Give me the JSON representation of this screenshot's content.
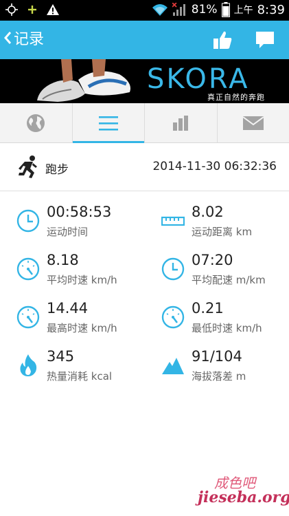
{
  "status_bar": {
    "battery": "81%",
    "ampm": "上午",
    "time": "8:39",
    "icons": [
      "gps-icon",
      "plus-icon",
      "warning-icon",
      "wifi-icon",
      "signal-icon",
      "battery-icon"
    ]
  },
  "header": {
    "back_label": "记录",
    "actions": [
      "thumbs-up-icon",
      "message-icon"
    ],
    "accent_color": "#33b5e5"
  },
  "banner": {
    "brand": "SKORA",
    "slogan": "真正自然的奔跑"
  },
  "tabs": [
    {
      "icon": "globe-icon",
      "active": false
    },
    {
      "icon": "list-icon",
      "active": true
    },
    {
      "icon": "bar-chart-icon",
      "active": false
    },
    {
      "icon": "mail-icon",
      "active": false
    }
  ],
  "activity": {
    "type": "跑步",
    "datetime": "2014-11-30 06:32:36"
  },
  "stats": [
    {
      "icon": "clock-icon",
      "value": "00:58:53",
      "label": "运动时间"
    },
    {
      "icon": "ruler-icon",
      "value": "8.02",
      "label": "运动距离 km"
    },
    {
      "icon": "speedometer-icon",
      "value": "8.18",
      "label": "平均时速 km/h"
    },
    {
      "icon": "clock-icon",
      "value": "07:20",
      "label": "平均配速 m/km"
    },
    {
      "icon": "speedometer-icon",
      "value": "14.44",
      "label": "最高时速 km/h"
    },
    {
      "icon": "speedometer-icon",
      "value": "0.21",
      "label": "最低时速 km/h"
    },
    {
      "icon": "flame-icon",
      "value": "345",
      "label": "热量消耗 kcal"
    },
    {
      "icon": "mountain-icon",
      "value": "91/104",
      "label": "海拔落差 m"
    }
  ],
  "watermark": {
    "top": "成色吧",
    "bottom": "jieseba.org"
  }
}
